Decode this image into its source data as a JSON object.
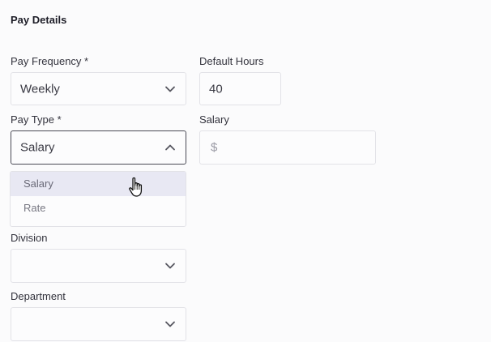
{
  "section": {
    "title": "Pay Details"
  },
  "pay_frequency": {
    "label": "Pay Frequency *",
    "value": "Weekly"
  },
  "default_hours": {
    "label": "Default Hours",
    "value": "40"
  },
  "pay_type": {
    "label": "Pay Type *",
    "value": "Salary",
    "options": [
      "Salary",
      "Rate"
    ],
    "hovered_option": "Salary"
  },
  "salary": {
    "label": "Salary",
    "placeholder": "$"
  },
  "division": {
    "label": "Division",
    "value": ""
  },
  "department": {
    "label": "Department",
    "value": ""
  },
  "icons": {
    "select_arrow": "chevron-down-icon",
    "open_select_arrow": "chevron-up-icon",
    "pointer": "hand-pointer-icon"
  },
  "colors": {
    "hover_option": "#e8e8f3",
    "focused_border": "#4a4a55"
  }
}
